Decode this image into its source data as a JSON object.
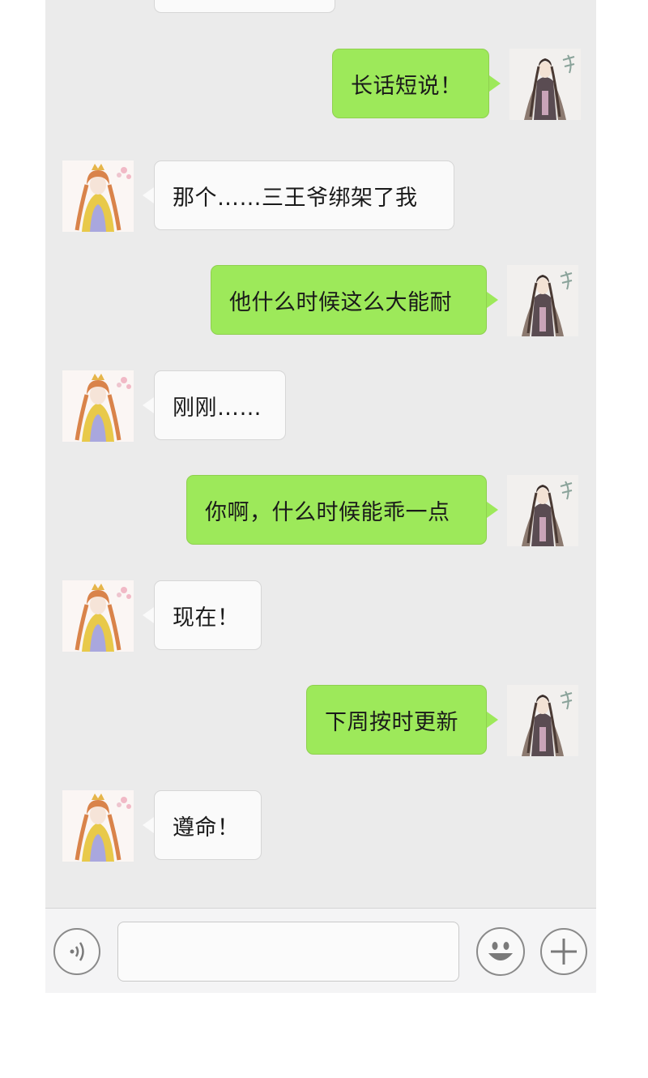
{
  "chat": {
    "messages": [
      {
        "sender": "me",
        "text": "长话短说！"
      },
      {
        "sender": "her",
        "text": "那个……三王爷绑架了我"
      },
      {
        "sender": "me",
        "text": "他什么时候这么大能耐"
      },
      {
        "sender": "her",
        "text": "刚刚……"
      },
      {
        "sender": "me",
        "text": "你啊，什么时候能乖一点"
      },
      {
        "sender": "her",
        "text": "现在！"
      },
      {
        "sender": "me",
        "text": "下周按时更新"
      },
      {
        "sender": "her",
        "text": "遵命！"
      }
    ]
  },
  "input_bar": {
    "voice_icon": "voice-icon",
    "emoji_icon": "smiley-icon",
    "more_icon": "plus-icon",
    "text_value": ""
  },
  "colors": {
    "chat_background": "#ebebeb",
    "my_bubble": "#9de95a",
    "her_bubble": "#fafafa",
    "input_bar_background": "#f4f4f5"
  }
}
